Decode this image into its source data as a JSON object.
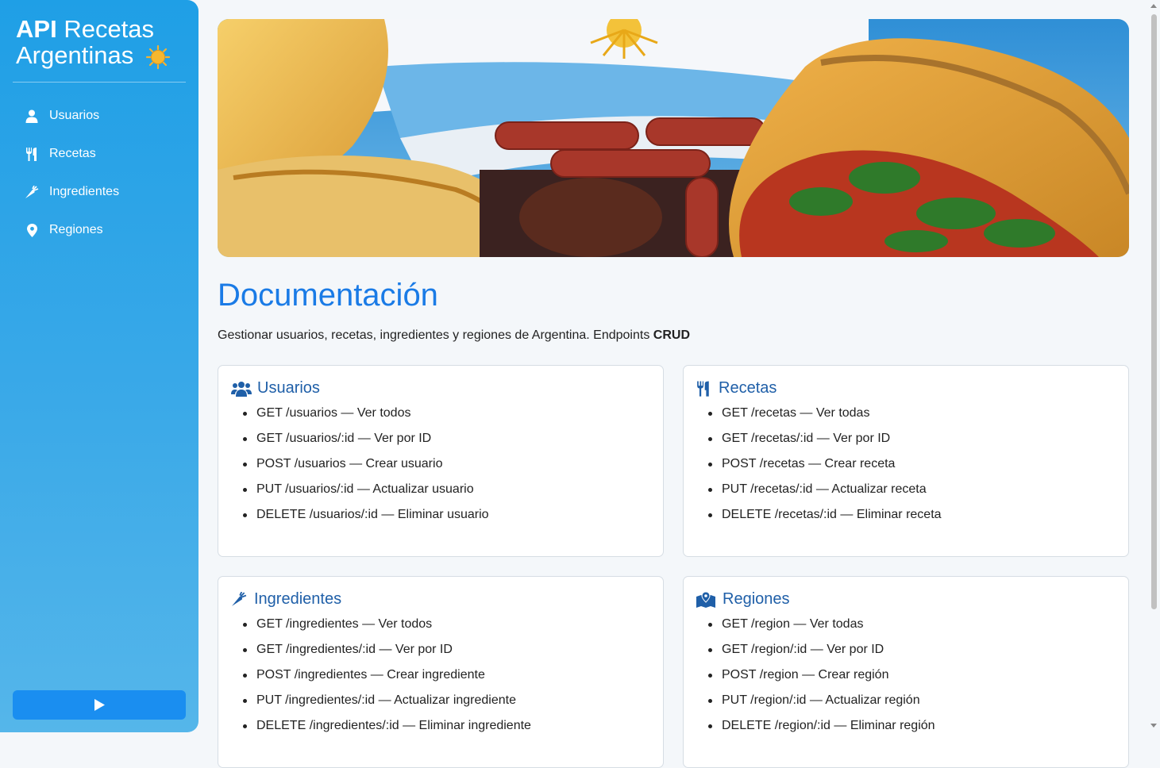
{
  "brand": {
    "title_bold": "API",
    "title_rest": "Recetas Argentinas",
    "icon": "sun-icon"
  },
  "nav": [
    {
      "label": "Usuarios",
      "icon": "user-icon"
    },
    {
      "label": "Recetas",
      "icon": "utensils-icon"
    },
    {
      "label": "Ingredientes",
      "icon": "carrot-icon"
    },
    {
      "label": "Regiones",
      "icon": "map-pin-icon"
    }
  ],
  "play_button": {
    "icon": "play-icon"
  },
  "hero": {
    "alt": "Comidas argentinas: empanadas, chorizos y choripán con bandera argentina"
  },
  "page": {
    "title": "Documentación",
    "subtitle_text": "Gestionar usuarios, recetas, ingredientes y regiones de Argentina. Endpoints ",
    "subtitle_bold": "CRUD"
  },
  "cards": [
    {
      "title": "Usuarios",
      "icon": "users-icon",
      "items": [
        "GET /usuarios — Ver todos",
        "GET /usuarios/:id — Ver por ID",
        "POST /usuarios — Crear usuario",
        "PUT /usuarios/:id — Actualizar usuario",
        "DELETE /usuarios/:id — Eliminar usuario"
      ]
    },
    {
      "title": "Recetas",
      "icon": "utensils-icon",
      "items": [
        "GET /recetas — Ver todas",
        "GET /recetas/:id — Ver por ID",
        "POST /recetas — Crear receta",
        "PUT /recetas/:id — Actualizar receta",
        "DELETE /recetas/:id — Eliminar receta"
      ]
    },
    {
      "title": "Ingredientes",
      "icon": "carrot-icon",
      "items": [
        "GET /ingredientes — Ver todos",
        "GET /ingredientes/:id — Ver por ID",
        "POST /ingredientes — Crear ingrediente",
        "PUT /ingredientes/:id — Actualizar ingrediente",
        "DELETE /ingredientes/:id — Eliminar ingrediente"
      ]
    },
    {
      "title": "Regiones",
      "icon": "map-location-icon",
      "items": [
        "GET /region — Ver todas",
        "GET /region/:id — Ver por ID",
        "POST /region — Crear región",
        "PUT /region/:id — Actualizar región",
        "DELETE /region/:id — Eliminar región"
      ]
    }
  ],
  "colors": {
    "sidebar": "#1f9fe6",
    "accent": "#1a7be6",
    "card_title": "#1f5fa8",
    "play_button": "#1a8ef0"
  }
}
